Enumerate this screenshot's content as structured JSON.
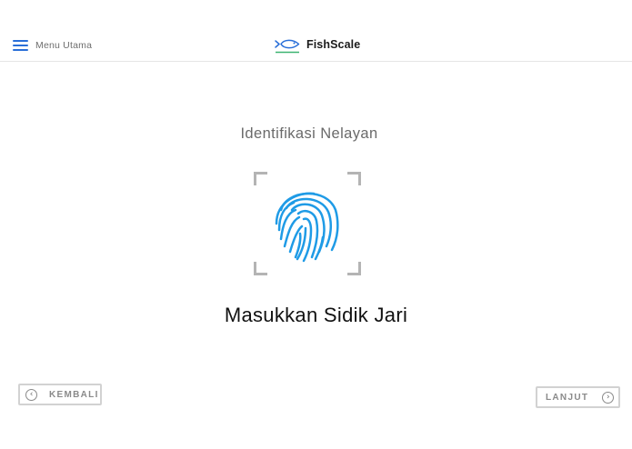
{
  "header": {
    "menu_label": "Menu Utama",
    "menu_icon": "hamburger-icon",
    "brand_name": "FishScale",
    "brand_icon": "fish-logo-icon"
  },
  "main": {
    "subtitle": "Identifikasi Nelayan",
    "fingerprint_icon": "fingerprint-icon",
    "instruction": "Masukkan Sidik Jari"
  },
  "footer": {
    "back_label": "KEMBALI",
    "back_icon": "chevron-left-icon",
    "next_label": "LANJUT",
    "next_icon": "chevron-right-icon"
  },
  "colors": {
    "accent_blue": "#2a6fd8",
    "fingerprint_blue": "#1f9be6",
    "logo_green": "#3cb371",
    "frame_gray": "#b4b4b4"
  }
}
